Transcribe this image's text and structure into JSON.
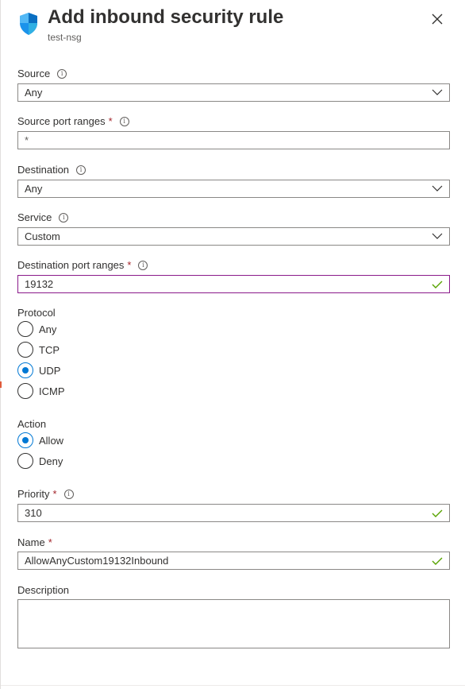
{
  "header": {
    "title": "Add inbound security rule",
    "subtitle": "test-nsg",
    "icon": "shield-icon",
    "close_icon": "close-icon"
  },
  "form": {
    "source": {
      "label": "Source",
      "value": "Any"
    },
    "source_port_ranges": {
      "label": "Source port ranges",
      "required": "*",
      "value": "*"
    },
    "destination": {
      "label": "Destination",
      "value": "Any"
    },
    "service": {
      "label": "Service",
      "value": "Custom"
    },
    "destination_port_ranges": {
      "label": "Destination port ranges",
      "required": "*",
      "value": "19132"
    },
    "protocol": {
      "label": "Protocol",
      "options": [
        "Any",
        "TCP",
        "UDP",
        "ICMP"
      ],
      "selected": "UDP"
    },
    "action": {
      "label": "Action",
      "options": [
        "Allow",
        "Deny"
      ],
      "selected": "Allow"
    },
    "priority": {
      "label": "Priority",
      "required": "*",
      "value": "310"
    },
    "name": {
      "label": "Name",
      "required": "*",
      "value": "AllowAnyCustom19132Inbound"
    },
    "description": {
      "label": "Description",
      "value": ""
    }
  },
  "colors": {
    "accent": "#0078d4",
    "valid": "#57a300",
    "required": "#a4262c",
    "focus_border": "#8a1a8a"
  }
}
